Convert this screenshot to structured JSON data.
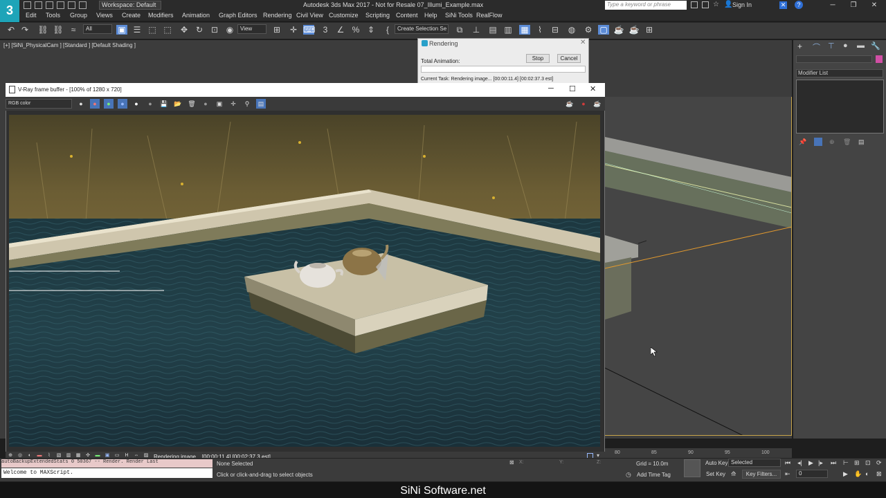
{
  "titlebar": {
    "workspace": "Workspace: Default",
    "title": "Autodesk 3ds Max 2017 - Not for Resale   07_Illumi_Example.max",
    "search_placeholder": "Type a keyword or phrase",
    "sign_in": "Sign In"
  },
  "menu": [
    "Edit",
    "Tools",
    "Group",
    "Views",
    "Create",
    "Modifiers",
    "Animation",
    "Graph Editors",
    "Rendering",
    "Civil View",
    "Customize",
    "Scripting",
    "Content",
    "Help",
    "SiNi Tools",
    "RealFlow"
  ],
  "toolbar": {
    "filter": "All",
    "ref_coord": "View",
    "selection_set": "Create Selection Se"
  },
  "viewport": {
    "label": "[+] [SiNi_PhysicalCam ] [Standard ] [Default Shading ]"
  },
  "command_panel": {
    "modifier_list": "Modifier List"
  },
  "render_dialog": {
    "title": "Rendering",
    "total_animation": "Total Animation:",
    "stop": "Stop",
    "cancel": "Cancel",
    "current_task": "Current Task:     Rendering image... [00:00:11.4] [00:02:37.3 est]"
  },
  "vfb": {
    "title": "V-Ray frame buffer - [100% of 1280 x 720]",
    "channel": "RGB color",
    "status": "Rendering image... [00:00:11.4] [00:02:37.3 est]"
  },
  "timeline": {
    "ticks": [
      "80",
      "85",
      "90",
      "95",
      "100"
    ]
  },
  "status": {
    "maxscript_output": "Welcome to MAXScript.",
    "maxscript_listener": "autoBackupExtendedStats 0  50367   -- Render. Render Last",
    "selection": "None Selected",
    "prompt": "Click or click-and-drag to select objects",
    "grid": "Grid = 10.0m",
    "add_time_tag": "Add Time Tag",
    "auto_key": "Auto Key",
    "set_key": "Set Key",
    "key_mode": "Selected",
    "key_filters": "Key Filters...",
    "frame": "0"
  },
  "watermark": "SiNi Software.net"
}
